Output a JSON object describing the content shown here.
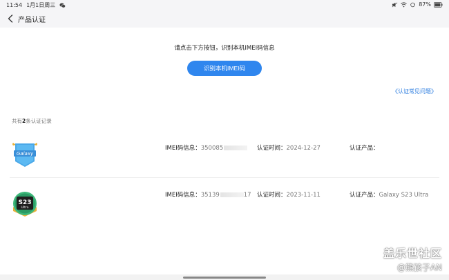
{
  "status": {
    "time": "11:54",
    "date": "1月1日周三",
    "battery": "87%"
  },
  "header": {
    "title": "产品认证"
  },
  "main": {
    "prompt": "请点击下方按钮，识别本机IMEI码信息",
    "identify_button": "识别本机IMEI码",
    "faq_link": "《认证常见问题》",
    "count_prefix": "共有",
    "count_value": "2",
    "count_suffix": "条认证记录"
  },
  "records": [
    {
      "badge_text": "Galaxy",
      "imei_label": "IMEI码信息：",
      "imei_value": "350085",
      "time_label": "认证时间：",
      "time_value": "2024-12-27",
      "product_label": "认证产品：",
      "product_value": ""
    },
    {
      "badge_text_main": "S23",
      "badge_text_sub": "Ultra",
      "imei_label": "IMEI码信息：",
      "imei_value": "35139",
      "imei_tail": "17",
      "time_label": "认证时间：",
      "time_value": "2023-11-11",
      "product_label": "认证产品：",
      "product_value": "Galaxy S23 Ultra"
    }
  ],
  "watermark": {
    "line1": "盖乐世社区",
    "line2": "@熊孩子AN"
  },
  "colors": {
    "accent": "#2f86ee",
    "link": "#2f7fe0",
    "header_bg": "#f5f5f7"
  }
}
